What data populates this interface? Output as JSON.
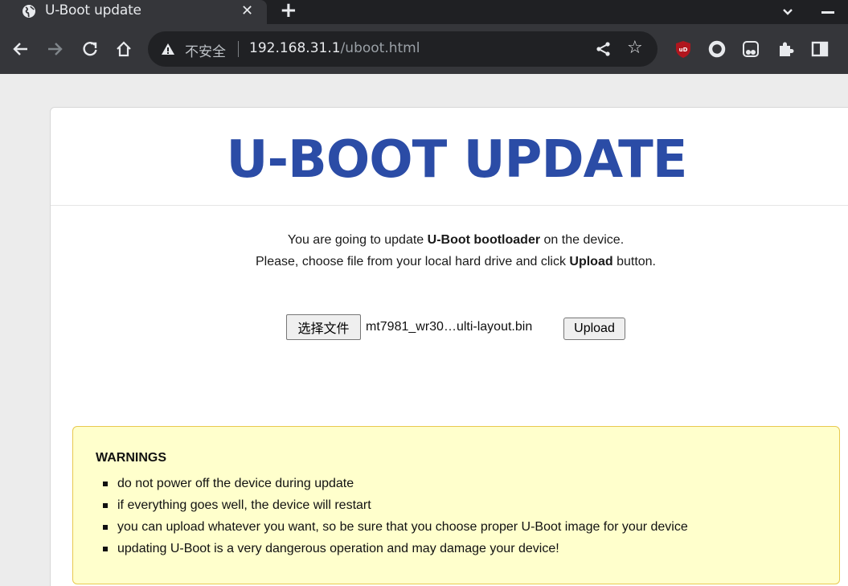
{
  "browser": {
    "tab_title": "U-Boot update",
    "tab_close": "✕",
    "new_tab": "+",
    "security_label": "不安全",
    "url_host": "192.168.31.1",
    "url_path": "/uboot.html",
    "bookmark_star": "☆",
    "extensions": [
      "ublock-origin-icon",
      "circle-extension-icon",
      "tampermonkey-icon",
      "puzzle-extensions-icon",
      "side-panel-icon"
    ]
  },
  "page": {
    "title": "U-BOOT UPDATE",
    "intro_line1": {
      "before": "You are going to update ",
      "bold": "U-Boot bootloader",
      "after": " on the device."
    },
    "intro_line2": {
      "before": "Please, choose file from your local hard drive and click ",
      "bold": "Upload",
      "after": " button."
    },
    "file_input": {
      "choose_label": "选择文件",
      "selected_file": "mt7981_wr30…ulti-layout.bin"
    },
    "upload_label": "Upload",
    "warnings": {
      "title": "WARNINGS",
      "items": [
        "do not power off the device during update",
        "if everything goes well, the device will restart",
        "you can upload whatever you want, so be sure that you choose proper U-Boot image for your device",
        "updating U-Boot is a very dangerous operation and may damage your device!"
      ]
    }
  },
  "colors": {
    "title": "#2b4ca6",
    "warning_bg": "#ffffcc",
    "warning_border": "#e8c94f",
    "chrome_dark": "#35363a"
  }
}
